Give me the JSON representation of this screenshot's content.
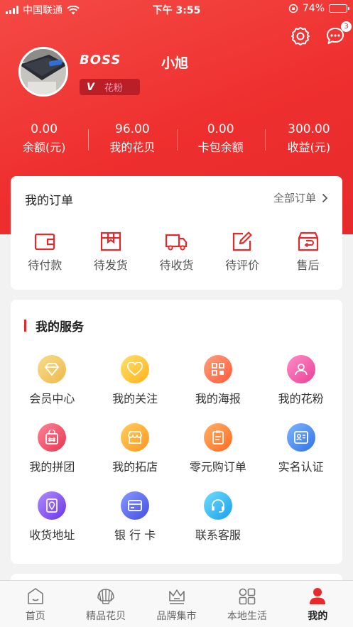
{
  "status_bar": {
    "carrier": "中国联通",
    "time": "下午 3:55",
    "battery": "74%",
    "battery_level": 0.74
  },
  "header": {
    "message_badge": "3"
  },
  "profile": {
    "logo_text": "BOSS",
    "username": "小旭",
    "level_badge": "花粉",
    "level_mark": "V"
  },
  "stats": [
    {
      "value": "0.00",
      "label": "余额(元)"
    },
    {
      "value": "96.00",
      "label": "我的花贝"
    },
    {
      "value": "0.00",
      "label": "卡包余额"
    },
    {
      "value": "300.00",
      "label": "收益(元)"
    }
  ],
  "orders": {
    "title": "我的订单",
    "all_label": "全部订单",
    "items": [
      {
        "label": "待付款",
        "icon": "wallet-icon"
      },
      {
        "label": "待发货",
        "icon": "box-icon"
      },
      {
        "label": "待收货",
        "icon": "truck-icon"
      },
      {
        "label": "待评价",
        "icon": "edit-icon"
      },
      {
        "label": "售后",
        "icon": "return-icon"
      }
    ]
  },
  "services": {
    "title": "我的服务",
    "items": [
      {
        "label": "会员中心",
        "icon": "diamond-icon",
        "color": "#f2c55a"
      },
      {
        "label": "我的关注",
        "icon": "heart-icon",
        "color": "#ffc93c"
      },
      {
        "label": "我的海报",
        "icon": "qrcode-icon",
        "color": "#ff7b5c"
      },
      {
        "label": "我的花粉",
        "icon": "fans-icon",
        "color": "#f25ea8"
      },
      {
        "label": "我的拼团",
        "icon": "group-bag-icon",
        "color": "#f0566b"
      },
      {
        "label": "我的拓店",
        "icon": "store-icon",
        "color": "#ffae2e"
      },
      {
        "label": "零元购订单",
        "icon": "clipboard-icon",
        "color": "#ff8a3c"
      },
      {
        "label": "实名认证",
        "icon": "id-card-icon",
        "color": "#4a8ef0"
      },
      {
        "label": "收货地址",
        "icon": "address-icon",
        "color": "#8b5cf0"
      },
      {
        "label": "银 行 卡",
        "icon": "bank-card-icon",
        "color": "#5b6cf0"
      },
      {
        "label": "联系客服",
        "icon": "headset-icon",
        "color": "#35b8f0"
      }
    ]
  },
  "tabbar": [
    {
      "label": "首页",
      "icon": "home-icon",
      "active": false
    },
    {
      "label": "精品花贝",
      "icon": "shell-icon",
      "active": false
    },
    {
      "label": "品牌集市",
      "icon": "crown-icon",
      "active": false
    },
    {
      "label": "本地生活",
      "icon": "grid-icon",
      "active": false
    },
    {
      "label": "我的",
      "icon": "user-icon",
      "active": true
    }
  ]
}
